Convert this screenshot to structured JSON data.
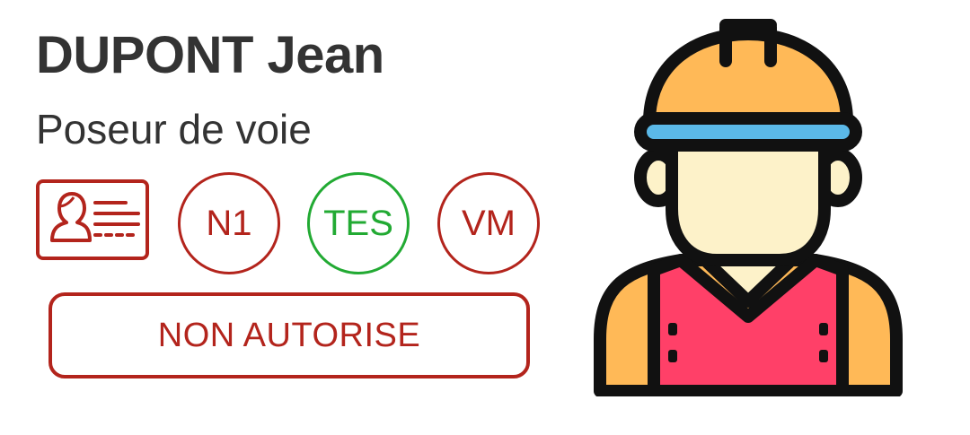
{
  "worker": {
    "name": "DUPONT Jean",
    "job_title": "Poseur de voie",
    "status": "NON AUTORISE",
    "avatar_icon": "construction-worker-icon"
  },
  "badges": {
    "id_card_icon": "id-card-icon",
    "items": [
      {
        "label": "N1",
        "state": "invalid",
        "color": "#b3241c"
      },
      {
        "label": "TES",
        "state": "valid",
        "color": "#22aa33"
      },
      {
        "label": "VM",
        "state": "invalid",
        "color": "#b3241c"
      }
    ]
  },
  "colors": {
    "text": "#333333",
    "alert_red": "#b3241c",
    "valid_green": "#22aa33",
    "helmet": "#ffb957",
    "helmet_band": "#5bb9e8",
    "skin": "#fdf2c9",
    "vest": "#ff4068",
    "outline": "#111111"
  }
}
